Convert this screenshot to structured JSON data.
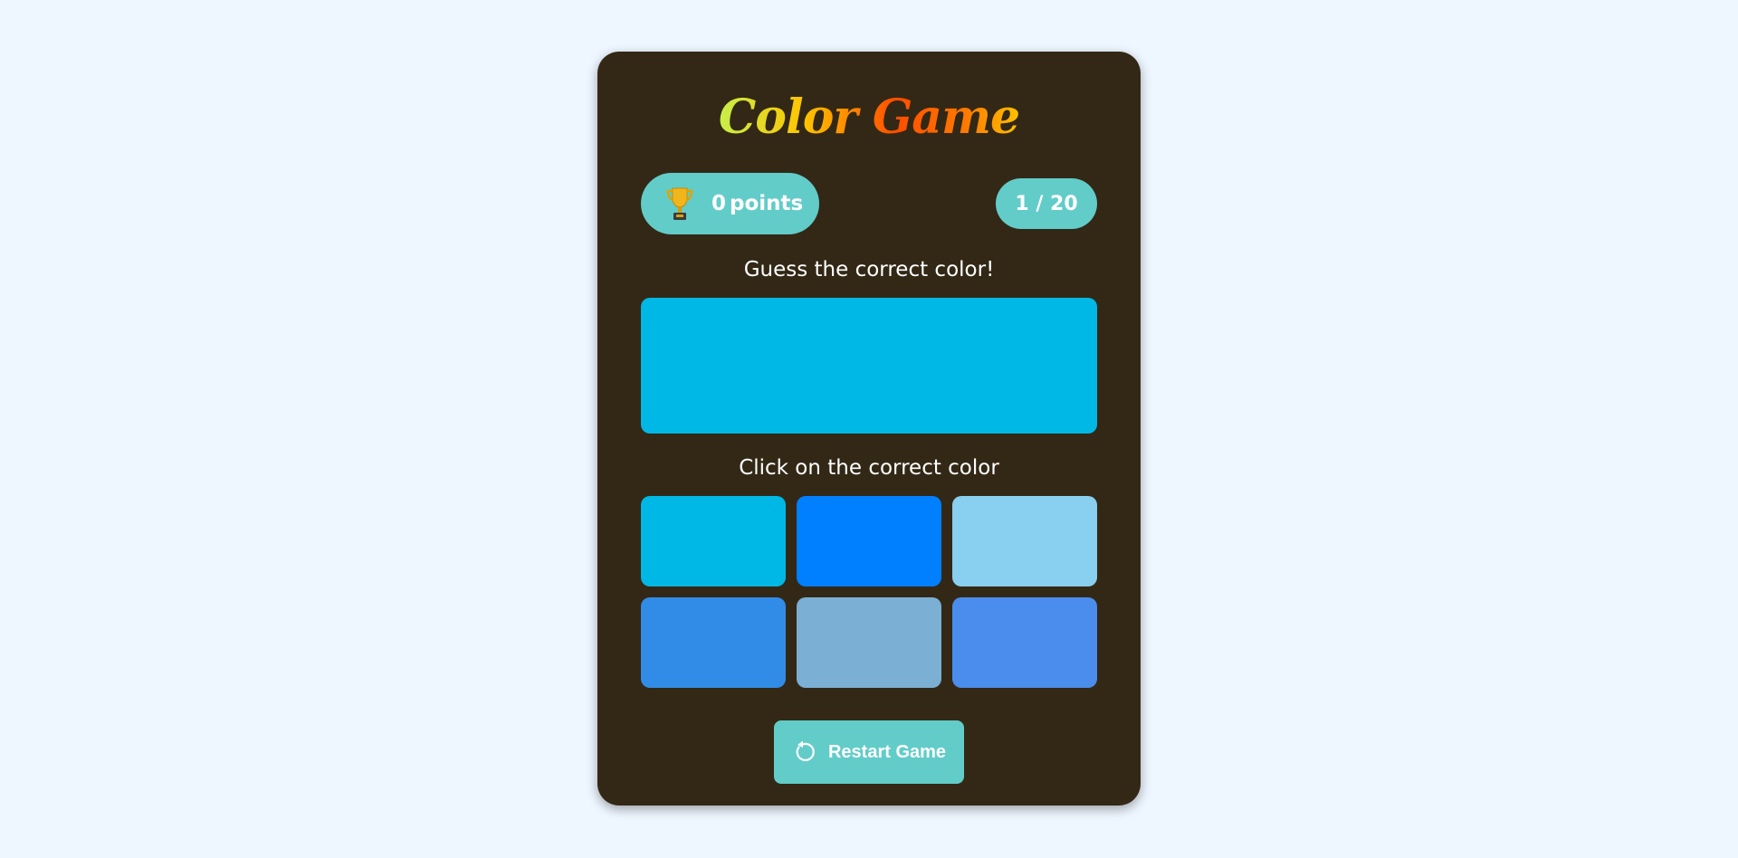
{
  "title": "Color Game",
  "score": {
    "icon": "trophy-icon",
    "value": "0",
    "unit": "points"
  },
  "round": {
    "label": "1 / 20",
    "current": 1,
    "total": 20
  },
  "guess_prompt": "Guess the correct color!",
  "target_color": "#00b8e6",
  "click_prompt": "Click on the correct color",
  "options": [
    {
      "color": "#00b8e6"
    },
    {
      "color": "#007fff"
    },
    {
      "color": "#89cfef"
    },
    {
      "color": "#318ce7"
    },
    {
      "color": "#7bafd4"
    },
    {
      "color": "#4a8ded"
    }
  ],
  "restart": {
    "icon": "restart-icon",
    "label": "Restart Game"
  },
  "colors": {
    "background": "#eef6ff",
    "card": "#332816",
    "accent": "#62ccc9",
    "text": "#ffffff"
  }
}
